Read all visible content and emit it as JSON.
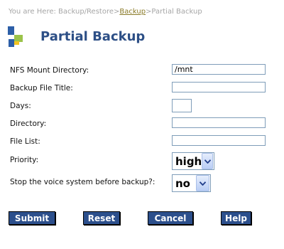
{
  "breadcrumb": {
    "prefix": "You are Here: Backup/Restore>",
    "link": "Backup",
    "suffix": ">Partial Backup"
  },
  "page": {
    "title": "Partial Backup"
  },
  "form": {
    "nfs_label": "NFS Mount Directory:",
    "nfs_value": "/mnt",
    "title_label": "Backup File Title:",
    "title_value": "",
    "days_label": "Days:",
    "days_value": "",
    "directory_label": "Directory:",
    "directory_value": "",
    "filelist_label": "File List:",
    "filelist_value": "",
    "priority_label": "Priority:",
    "priority_value": "high",
    "stop_label": "Stop the voice system before backup?:",
    "stop_value": "no"
  },
  "buttons": {
    "submit": "Submit",
    "reset": "Reset",
    "cancel": "Cancel",
    "help": "Help"
  },
  "colors": {
    "title": "#2d4f86",
    "button": "#2c4f8c",
    "link": "#8a7a28"
  }
}
